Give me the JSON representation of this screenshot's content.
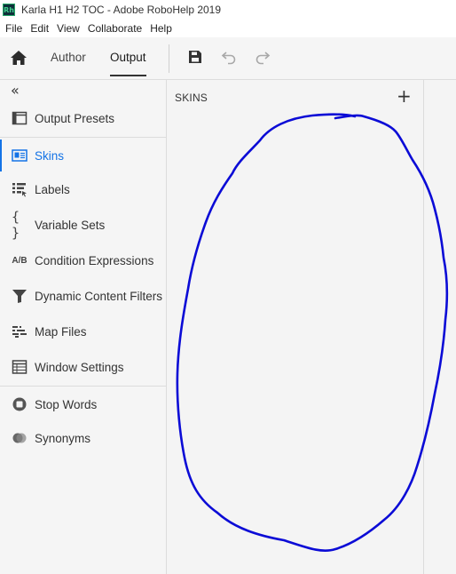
{
  "window": {
    "logo_text": "Rh",
    "title": "Karla H1 H2 TOC - Adobe RoboHelp 2019"
  },
  "menu": [
    "File",
    "Edit",
    "View",
    "Collaborate",
    "Help"
  ],
  "toolbar": {
    "tabs": [
      {
        "label": "Author",
        "active": false
      },
      {
        "label": "Output",
        "active": true
      }
    ],
    "icons": [
      "home-icon",
      "save-icon",
      "undo-icon",
      "redo-icon"
    ]
  },
  "sidebar": {
    "collapse_glyph": "«",
    "items": [
      {
        "label": "Output Presets",
        "icon": "output-presets-icon"
      },
      {
        "label": "Skins",
        "icon": "skins-icon",
        "active": true
      },
      {
        "label": "Labels",
        "icon": "labels-icon"
      },
      {
        "label": "Variable Sets",
        "icon": "braces-icon"
      },
      {
        "label": "Condition Expressions",
        "icon": "ab-icon",
        "icon_text": "A/B"
      },
      {
        "label": "Dynamic Content Filters",
        "icon": "filter-icon"
      },
      {
        "label": "Map Files",
        "icon": "map-files-icon"
      },
      {
        "label": "Window Settings",
        "icon": "window-settings-icon"
      },
      {
        "label": "Stop Words",
        "icon": "stop-words-icon"
      },
      {
        "label": "Synonyms",
        "icon": "synonyms-icon"
      }
    ]
  },
  "panel": {
    "title": "SKINS",
    "add_glyph": "+"
  },
  "colors": {
    "accent": "#1473e6",
    "annotation": "#0b0bd6"
  }
}
